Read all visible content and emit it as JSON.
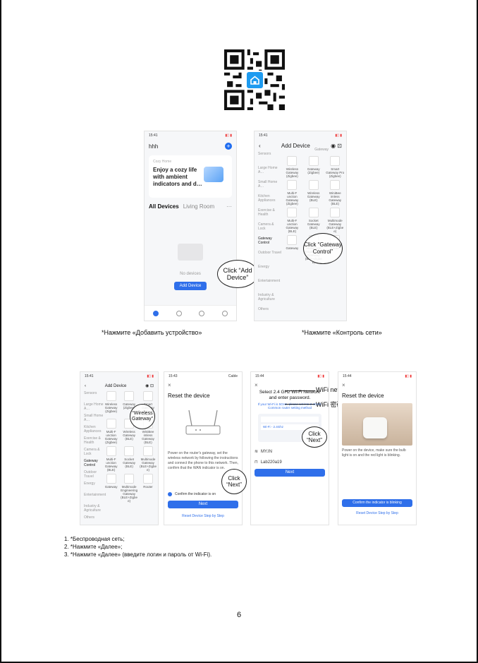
{
  "step1": {
    "status_time": "15:41",
    "home_name": "hhh",
    "card_label": "Cozy Home",
    "card_text": "Enjoy a cozy life with ambient indicators and d…",
    "tab_all": "All Devices",
    "tab_room": "Living Room",
    "no_devices": "No devices",
    "add_button": "Add Device",
    "callout": "Click “Add Device”",
    "caption": "*Нажмите «Добавить устройство»"
  },
  "step2": {
    "status_time": "15:41",
    "title": "Add Device",
    "section": "Gateway",
    "categories": [
      "Sensors",
      "Large Home A…",
      "Small Home A…",
      "Kitchen Appliances",
      "Exercise & Health",
      "Camera & Lock",
      "Gateway Control",
      "Outdoor Travel",
      "Energy",
      "Entertainment",
      "Industry & Agriculture",
      "Others"
    ],
    "devices": [
      "Wireless Gateway (Zigbee)",
      "Gateway (Zigbee)",
      "Smart Gateway Pro (Zigbee)",
      "Multi-F unction Gateway (Zigbee)",
      "Wireless Gateway (BLE)",
      "WiniBee imless Gateway (BLE)",
      "Multi-F unction Gateway (BLE)",
      "Socket Gateway (BLE)",
      "Multimode Gateway (BLE+Zigbe e)",
      "Gateway",
      "Multimode Engineering Gateway (BLE+Zigbe e)",
      "Router"
    ],
    "router_label": "Router",
    "callout": "Click “Gateway Control”",
    "caption": "*Нажмите «Контроль сети»"
  },
  "step3": {
    "status_time": "15:41",
    "title": "Add Device",
    "callout": "“Wireless Gateway”"
  },
  "step4": {
    "status_time": "15:43",
    "cable": "Cable",
    "title": "Reset the device",
    "body": "Power on the router's gateway, set the wireless network by following the instructions and connect the phone to this network. Then, confirm that the WAN indicator is on.",
    "confirm": "Confirm the indicator is on",
    "next": "Next",
    "link": "Reset Device Step by Step",
    "callout": "Click “Next”"
  },
  "step5": {
    "status_time": "15:44",
    "title": "Select 2.4 GHz Wi-Fi Network and enter password.",
    "hint": "If your Wi-Fi is 5GHz, please set it to 2.4GHz. Common router setting method",
    "wifi_label": "Wi-Fi - 2.4Ghz",
    "ssid": "MY.IN",
    "password": "Lab220a19",
    "next": "Next",
    "wifi_network_label": "WiFi network",
    "wifi_password_label": "WiFi 密码",
    "callout": "Click “Next”"
  },
  "step6": {
    "status_time": "15:44",
    "title": "Reset the device",
    "body": "Power on the device, make sure the bulb light is on and the red light is blinking.",
    "confirm_button": "Confirm the indicator is blinking",
    "link": "Reset Device Step by Step"
  },
  "instructions": [
    "1. *Беспроводная сеть;",
    "2. *Нажмите «Далее»;",
    "3. *Нажмите «Далее» (введите логин и пароль от Wi-Fi)."
  ],
  "page_number": "6",
  "colors": {
    "accent": "#2f6fea",
    "app_icon": "#1e9bf0"
  }
}
